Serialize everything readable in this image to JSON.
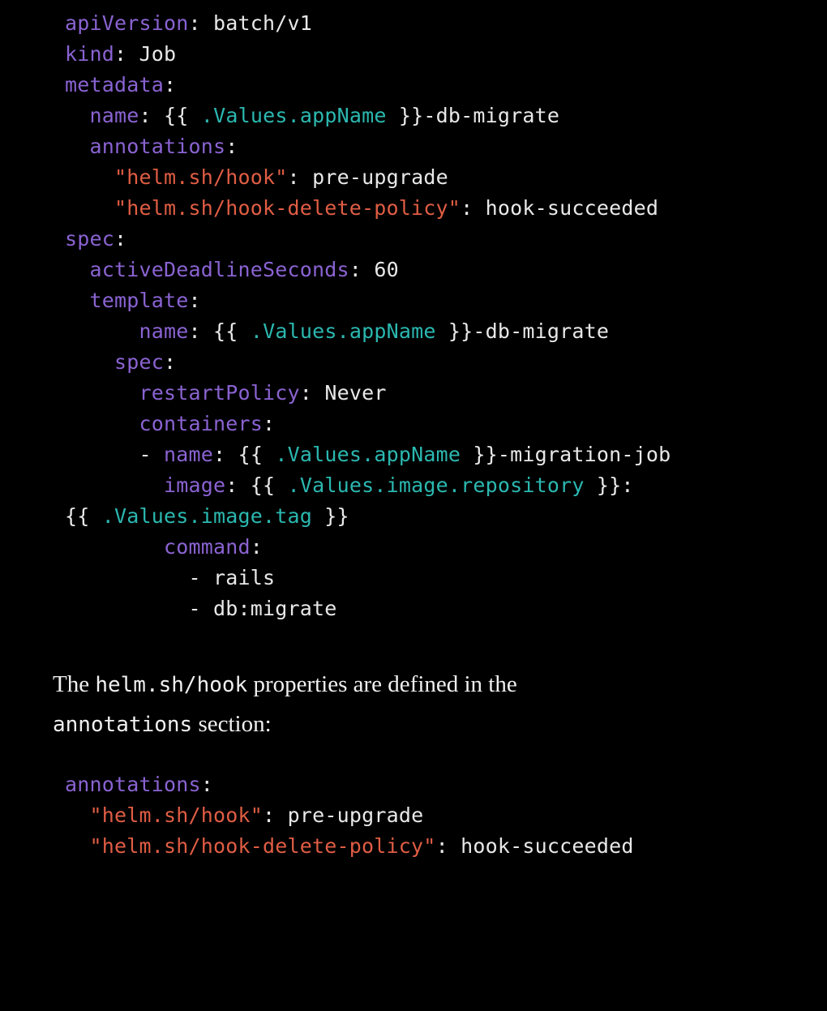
{
  "code1": {
    "l1": "apiVersion",
    "l1v": "batch/v1",
    "l2": "kind",
    "l2v": "Job",
    "l3": "metadata",
    "l4": "name",
    "l4b1": "{{ ",
    "l4t": ".Values.appName",
    "l4b2": " }}",
    "l4v": "-db-migrate",
    "l5": "annotations",
    "l6s": "\"helm.sh/hook\"",
    "l6v": "pre-upgrade",
    "l7s": "\"helm.sh/hook-delete-policy\"",
    "l7v": "hook-succeeded",
    "l8": "spec",
    "l9": "activeDeadlineSeconds",
    "l9v": "60",
    "l10": "template",
    "l11": "name",
    "l11b1": "{{ ",
    "l11t": ".Values.appName",
    "l11b2": " }}",
    "l11v": "-db-migrate",
    "l12": "spec",
    "l13": "restartPolicy",
    "l13v": "Never",
    "l14": "containers",
    "l15": "name",
    "l15b1": "{{ ",
    "l15t": ".Values.appName",
    "l15b2": " }}",
    "l15v": "-migration-job",
    "l16": "image",
    "l16b1": "{{ ",
    "l16t": ".Values.image.repository",
    "l16b2": " }}",
    "l16v": ":",
    "l17b1": "{{ ",
    "l17t": ".Values.image.tag",
    "l17b2": " }}",
    "l18": "command",
    "l19": "rails",
    "l20": "db:migrate"
  },
  "prose": {
    "p1a": "The ",
    "p1b": "helm.sh/hook",
    "p1c": " properties are defined in the ",
    "p2a": "annotations",
    "p2b": " section:"
  },
  "code2": {
    "l1": "annotations",
    "l2s": "\"helm.sh/hook\"",
    "l2v": "pre-upgrade",
    "l3s": "\"helm.sh/hook-delete-policy\"",
    "l3v": "hook-succeeded"
  }
}
